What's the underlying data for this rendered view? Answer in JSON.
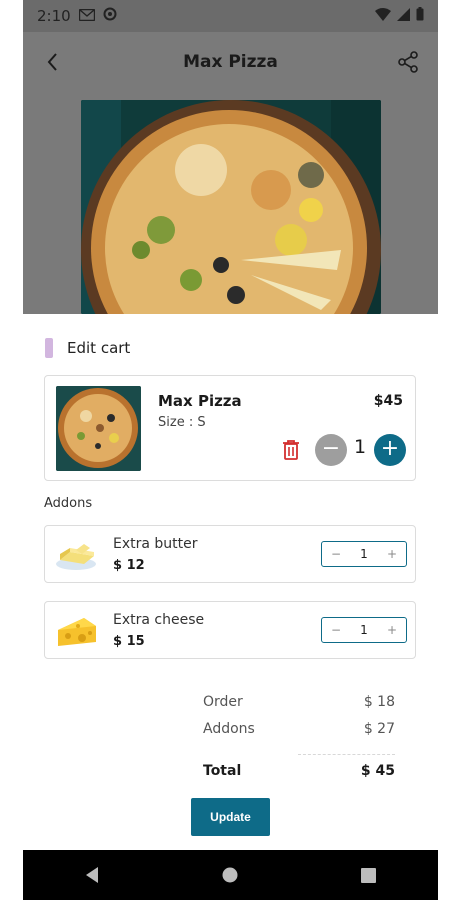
{
  "status_bar": {
    "time": "2:10"
  },
  "header": {
    "title": "Max Pizza"
  },
  "sheet": {
    "title": "Edit cart"
  },
  "cart_item": {
    "name": "Max Pizza",
    "size": "Size : S",
    "price": "$45",
    "quantity": "1",
    "minus_symbol": "−",
    "plus_symbol": "+"
  },
  "addons": {
    "label": "Addons",
    "items": [
      {
        "name": "Extra butter",
        "price": "$ 12",
        "quantity": "1",
        "icon": "butter-icon"
      },
      {
        "name": "Extra cheese",
        "price": "$ 15",
        "quantity": "1",
        "icon": "cheese-icon"
      }
    ],
    "minus_symbol": "−",
    "plus_symbol": "+"
  },
  "summary": {
    "order_label": "Order",
    "order_value": "$ 18",
    "addons_label": "Addons",
    "addons_value": "$ 27",
    "total_label": "Total",
    "total_value": "$ 45"
  },
  "actions": {
    "update_label": "Update"
  },
  "colors": {
    "accent": "#0e6b88",
    "delete": "#d32f2f",
    "sheet_accent": "#d2b6df"
  }
}
